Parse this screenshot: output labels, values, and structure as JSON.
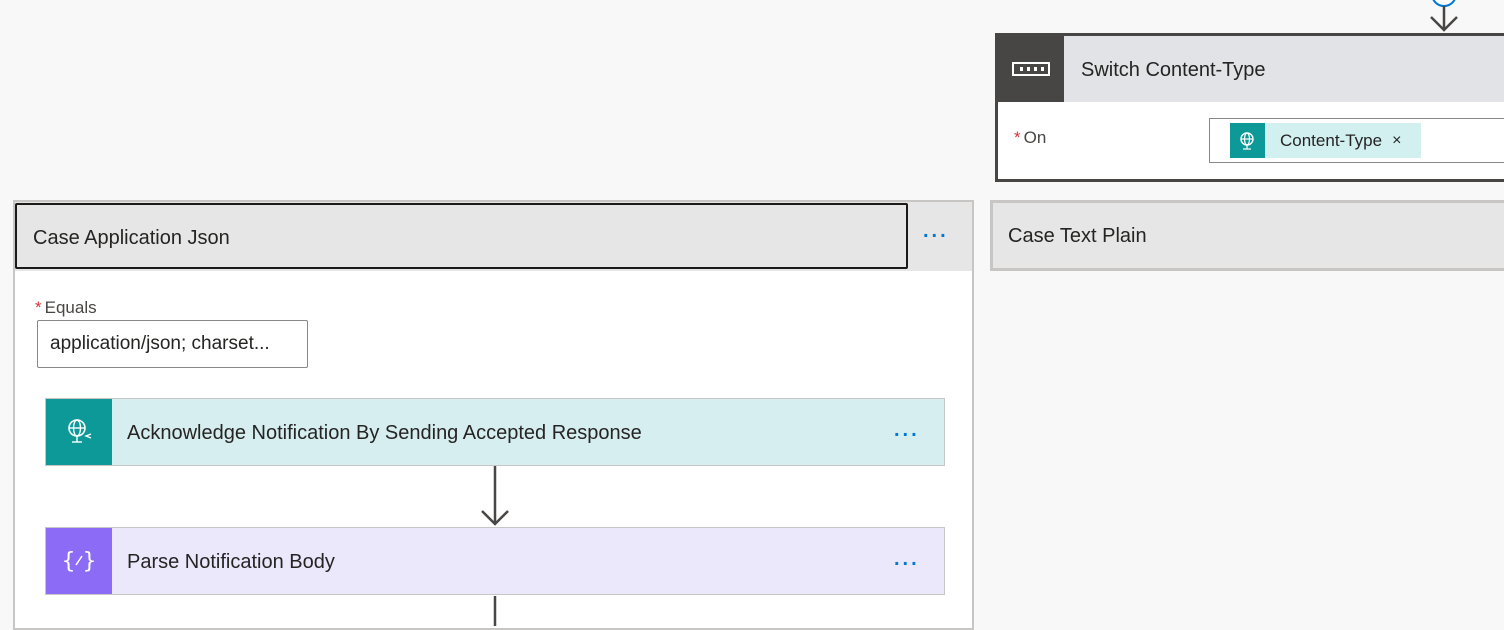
{
  "switch": {
    "title": "Switch Content-Type",
    "icon": "switch-icon",
    "on_label": "On",
    "required_marker": "*",
    "token": {
      "label": "Content-Type",
      "icon": "http-request-icon",
      "remove": "×"
    }
  },
  "case_application_json": {
    "title": "Case Application Json",
    "more": "...",
    "equals_label": "Equals",
    "required_marker": "*",
    "equals_value": "application/json; charset...",
    "actions": [
      {
        "title": "Acknowledge Notification By Sending Accepted Response",
        "icon": "http-response-icon",
        "color": "#0e9999",
        "more": "..."
      },
      {
        "title": "Parse Notification Body",
        "icon": "parse-json-icon",
        "color": "#8c6cf6",
        "more": "..."
      }
    ]
  },
  "case_text_plain": {
    "title": "Case Text Plain"
  },
  "colors": {
    "accent": "#0078d4",
    "required": "#d13438",
    "switch_dark": "#484644"
  }
}
